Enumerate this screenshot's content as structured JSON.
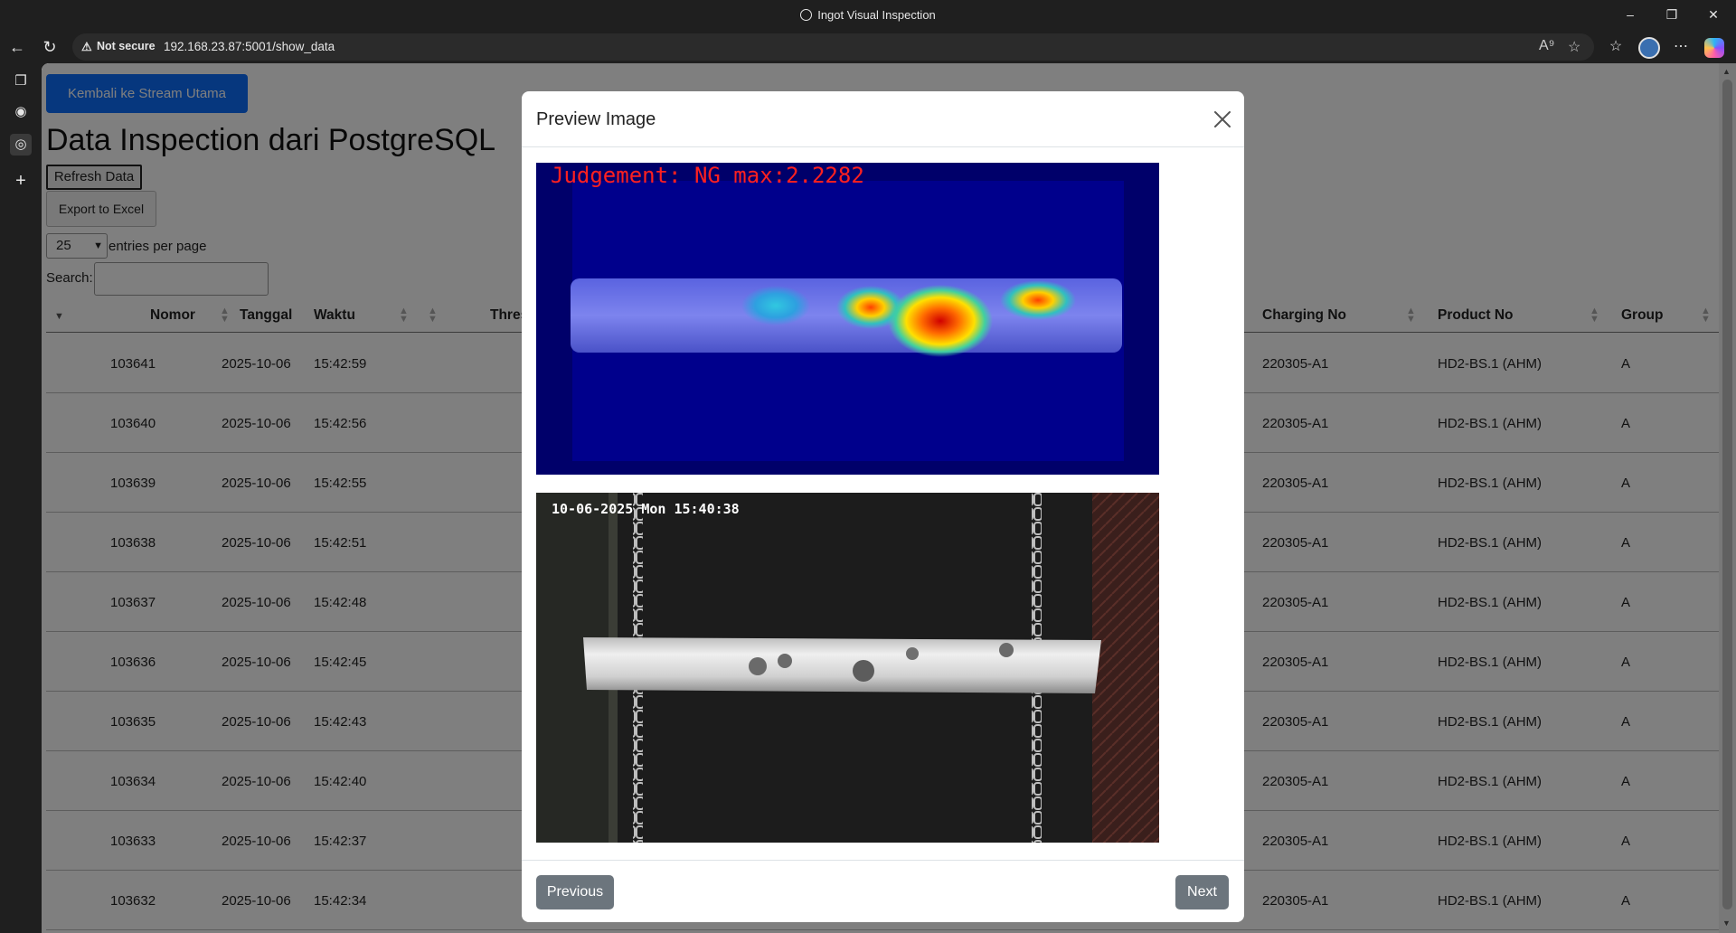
{
  "window": {
    "title": "Ingot Visual Inspection",
    "minimize_icon": "minimize-icon",
    "restore_icon": "restore-icon",
    "close_icon": "close-icon"
  },
  "address_bar": {
    "security_label": "Not secure",
    "url": "192.168.23.87:5001/show_data"
  },
  "page": {
    "back_button_label": "Kembali ke Stream Utama",
    "title": "Data Inspection dari PostgreSQL",
    "refresh_label": "Refresh Data",
    "export_label": "Export to Excel",
    "page_size_value": "25",
    "page_size_label": "entries per page",
    "search_label": "Search:",
    "search_value": ""
  },
  "table": {
    "headers": {
      "nomor": "Nomor",
      "tanggal": "Tanggal",
      "waktu": "Waktu",
      "threshold_partial": "Thres",
      "charging_no": "Charging No",
      "product_no": "Product No",
      "group": "Group"
    },
    "rows": [
      {
        "nomor": "103641",
        "tanggal": "2025-10-06",
        "waktu": "15:42:59",
        "charging_no": "220305-A1",
        "product_no": "HD2-BS.1 (AHM)",
        "group": "A"
      },
      {
        "nomor": "103640",
        "tanggal": "2025-10-06",
        "waktu": "15:42:56",
        "charging_no": "220305-A1",
        "product_no": "HD2-BS.1 (AHM)",
        "group": "A"
      },
      {
        "nomor": "103639",
        "tanggal": "2025-10-06",
        "waktu": "15:42:55",
        "charging_no": "220305-A1",
        "product_no": "HD2-BS.1 (AHM)",
        "group": "A"
      },
      {
        "nomor": "103638",
        "tanggal": "2025-10-06",
        "waktu": "15:42:51",
        "charging_no": "220305-A1",
        "product_no": "HD2-BS.1 (AHM)",
        "group": "A"
      },
      {
        "nomor": "103637",
        "tanggal": "2025-10-06",
        "waktu": "15:42:48",
        "charging_no": "220305-A1",
        "product_no": "HD2-BS.1 (AHM)",
        "group": "A"
      },
      {
        "nomor": "103636",
        "tanggal": "2025-10-06",
        "waktu": "15:42:45",
        "charging_no": "220305-A1",
        "product_no": "HD2-BS.1 (AHM)",
        "group": "A"
      },
      {
        "nomor": "103635",
        "tanggal": "2025-10-06",
        "waktu": "15:42:43",
        "charging_no": "220305-A1",
        "product_no": "HD2-BS.1 (AHM)",
        "group": "A"
      },
      {
        "nomor": "103634",
        "tanggal": "2025-10-06",
        "waktu": "15:42:40",
        "charging_no": "220305-A1",
        "product_no": "HD2-BS.1 (AHM)",
        "group": "A"
      },
      {
        "nomor": "103633",
        "tanggal": "2025-10-06",
        "waktu": "15:42:37",
        "charging_no": "220305-A1",
        "product_no": "HD2-BS.1 (AHM)",
        "group": "A"
      },
      {
        "nomor": "103632",
        "tanggal": "2025-10-06",
        "waktu": "15:42:34",
        "charging_no": "220305-A1",
        "product_no": "HD2-BS.1 (AHM)",
        "group": "A"
      }
    ]
  },
  "modal": {
    "title": "Preview Image",
    "heatmap_caption": "Judgement: NG max:2.2282",
    "camera_timestamp": "10-06-2025 Mon 15:40:38",
    "previous_label": "Previous",
    "next_label": "Next"
  },
  "colors": {
    "primary": "#0d6efd",
    "secondary": "#6c757d",
    "ng_red": "#ff2020",
    "heatmap_bg": "#00007a"
  }
}
